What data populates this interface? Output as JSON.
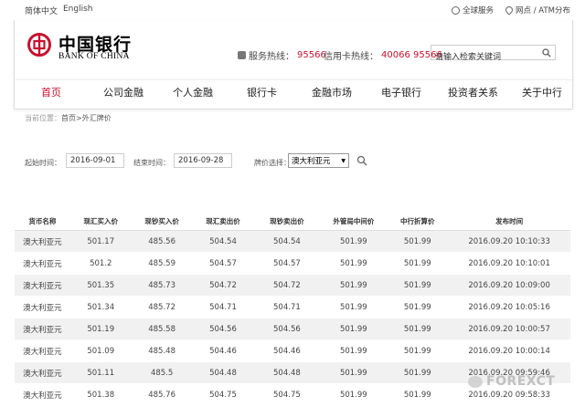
{
  "topbar": {
    "lang_cn": "简体中文",
    "lang_en": "English",
    "global_services": "全球服务",
    "outlets": "网点 / ATM分布"
  },
  "header": {
    "logo_cn": "中国银行",
    "logo_en": "BANK OF CHINA",
    "service_hotline_label": "服务热线：",
    "service_hotline_number": "95566",
    "credit_hotline_label": "信用卡热线：",
    "credit_hotline_number": "40066 95566",
    "search_placeholder": "请输入检索关键词",
    "brand_color": "#c8102e"
  },
  "nav": {
    "items": [
      "首页",
      "公司金融",
      "个人金融",
      "银行卡",
      "金融市场",
      "电子银行",
      "投资者关系",
      "关于中行"
    ],
    "active_index": 0
  },
  "breadcrumb": {
    "label": "当前位置：",
    "path": "首页>外汇牌价"
  },
  "filters": {
    "start_label": "起始时间：",
    "start_value": "2016-09-01",
    "end_label": "结束时间：",
    "end_value": "2016-09-28",
    "currency_label": "牌价选择：",
    "currency_value": "澳大利亚元"
  },
  "table": {
    "headers": [
      "货币名称",
      "现汇买入价",
      "现钞买入价",
      "现汇卖出价",
      "现钞卖出价",
      "外管局中间价",
      "中行折算价",
      "发布时间"
    ],
    "rows": [
      [
        "澳大利亚元",
        "501.17",
        "485.56",
        "504.54",
        "504.54",
        "501.99",
        "501.99",
        "2016.09.20 10:10:33"
      ],
      [
        "澳大利亚元",
        "501.2",
        "485.59",
        "504.57",
        "504.57",
        "501.99",
        "501.99",
        "2016.09.20 10:10:01"
      ],
      [
        "澳大利亚元",
        "501.35",
        "485.73",
        "504.72",
        "504.72",
        "501.99",
        "501.99",
        "2016.09.20 10:09:00"
      ],
      [
        "澳大利亚元",
        "501.34",
        "485.72",
        "504.71",
        "504.71",
        "501.99",
        "501.99",
        "2016.09.20 10:05:16"
      ],
      [
        "澳大利亚元",
        "501.19",
        "485.58",
        "504.56",
        "504.56",
        "501.99",
        "501.99",
        "2016.09.20 10:00:57"
      ],
      [
        "澳大利亚元",
        "501.09",
        "485.48",
        "504.46",
        "504.46",
        "501.99",
        "501.99",
        "2016.09.20 10:00:14"
      ],
      [
        "澳大利亚元",
        "501.11",
        "485.5",
        "504.48",
        "504.48",
        "501.99",
        "501.99",
        "2016.09.20 09:59:46"
      ],
      [
        "澳大利亚元",
        "501.38",
        "485.76",
        "504.75",
        "504.75",
        "501.99",
        "501.99",
        "2016.09.20 09:58:33"
      ]
    ]
  },
  "watermark": "FOREXCT"
}
